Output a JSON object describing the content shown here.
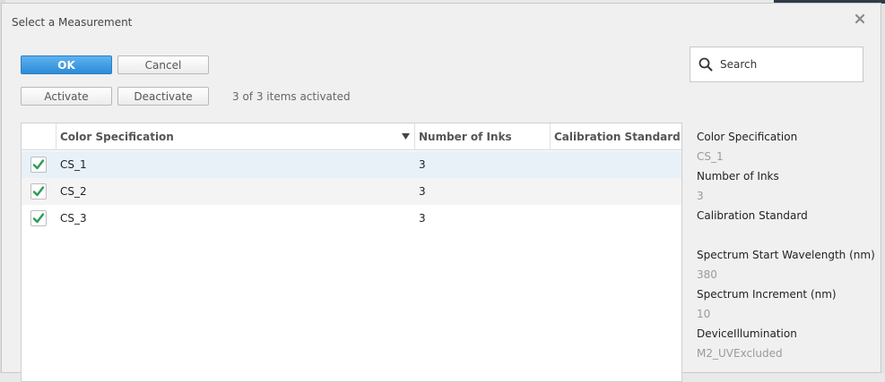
{
  "dialog": {
    "title": "Select a Measurement"
  },
  "buttons": {
    "ok": "OK",
    "cancel": "Cancel",
    "activate": "Activate",
    "deactivate": "Deactivate"
  },
  "status": "3 of 3 items activated",
  "search": {
    "placeholder": "Search"
  },
  "table": {
    "columns": [
      "Color Specification",
      "Number of Inks",
      "Calibration Standard"
    ],
    "rows": [
      {
        "name": "CS_1",
        "inks": "3",
        "calibration": "",
        "checked": true
      },
      {
        "name": "CS_2",
        "inks": "3",
        "calibration": "",
        "checked": true
      },
      {
        "name": "CS_3",
        "inks": "3",
        "calibration": "",
        "checked": true
      }
    ]
  },
  "details": [
    {
      "label": "Color Specification",
      "value": "CS_1"
    },
    {
      "label": "Number of Inks",
      "value": "3"
    },
    {
      "label": "Calibration Standard",
      "value": ""
    },
    {
      "label": "Spectrum Start Wavelength (nm)",
      "value": "380"
    },
    {
      "label": "Spectrum Increment (nm)",
      "value": "10"
    },
    {
      "label": "DeviceIllumination",
      "value": "M2_UVExcluded"
    }
  ],
  "colors": {
    "primary": "#2c8bd8",
    "check": "#2e9b57",
    "selected_row": "#e8f1f8"
  },
  "icons": {
    "close": "close-icon",
    "search": "search-icon",
    "sort": "sort-down-icon",
    "check": "checkmark-icon"
  }
}
